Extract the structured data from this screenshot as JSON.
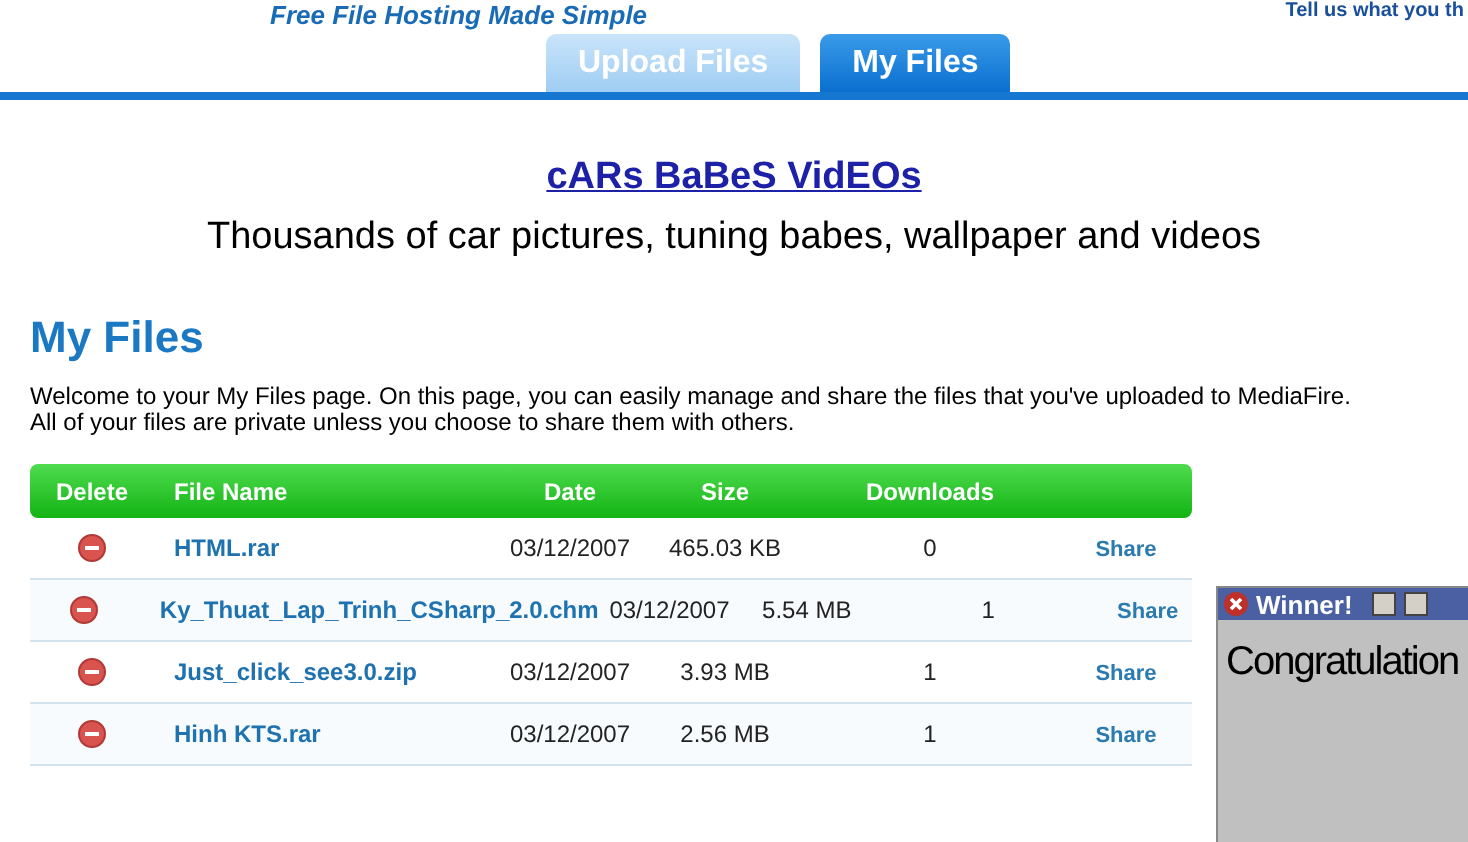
{
  "header": {
    "tagline": "Free File Hosting Made Simple",
    "feedback_link": "Tell us what you th"
  },
  "tabs": [
    {
      "label": "Upload Files",
      "selected": false
    },
    {
      "label": "My Files",
      "selected": true
    }
  ],
  "ad": {
    "link": "cARs BaBeS VidEOs",
    "description": "Thousands of car pictures, tuning babes, wallpaper and videos"
  },
  "page": {
    "title": "My Files",
    "intro": "Welcome to your My Files page. On this page, you can easily manage and share the files that you've uploaded to MediaFire.",
    "privacy_note": "All of your files are private unless you choose to share them with others."
  },
  "table": {
    "columns": [
      "Delete",
      "File Name",
      "Date",
      "Size",
      "Downloads"
    ],
    "rows": [
      {
        "file_name": "HTML.rar",
        "date": "03/12/2007",
        "size": "465.03 KB",
        "downloads": "0",
        "action": "Share"
      },
      {
        "file_name": "Ky_Thuat_Lap_Trinh_CSharp_2.0.chm",
        "date": "03/12/2007",
        "size": "5.54 MB",
        "downloads": "1",
        "action": "Share"
      },
      {
        "file_name": "Just_click_see3.0.zip",
        "date": "03/12/2007",
        "size": "3.93 MB",
        "downloads": "1",
        "action": "Share"
      },
      {
        "file_name": "Hinh KTS.rar",
        "date": "03/12/2007",
        "size": "2.56 MB",
        "downloads": "1",
        "action": "Share"
      }
    ]
  },
  "popup": {
    "title": "Winner!",
    "message": "Congratulation"
  }
}
